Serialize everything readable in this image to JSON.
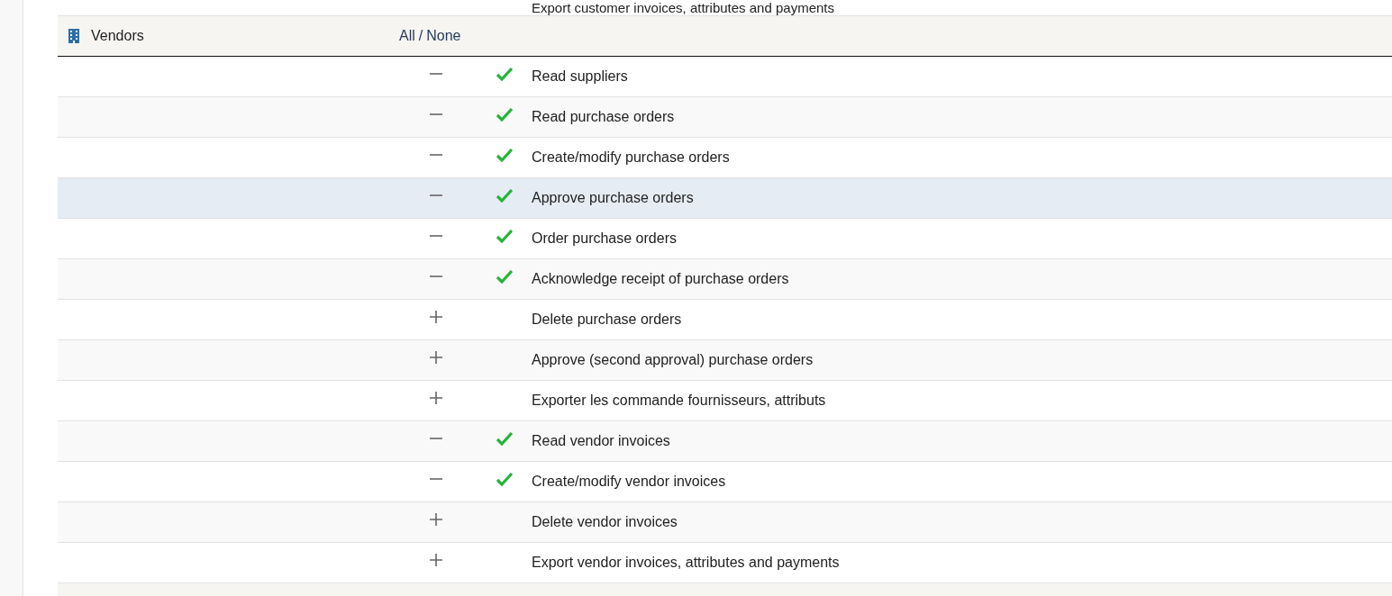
{
  "previous_row": {
    "label": "Export customer invoices, attributes and payments"
  },
  "section": {
    "title": "Vendors",
    "select_all": "All",
    "separator": "/",
    "select_none": "None"
  },
  "permissions": [
    {
      "label": "Read suppliers",
      "granted": true,
      "highlighted": false
    },
    {
      "label": "Read purchase orders",
      "granted": true,
      "highlighted": false
    },
    {
      "label": "Create/modify purchase orders",
      "granted": true,
      "highlighted": false
    },
    {
      "label": "Approve purchase orders",
      "granted": true,
      "highlighted": true
    },
    {
      "label": "Order purchase orders",
      "granted": true,
      "highlighted": false
    },
    {
      "label": "Acknowledge receipt of purchase orders",
      "granted": true,
      "highlighted": false
    },
    {
      "label": "Delete purchase orders",
      "granted": false,
      "highlighted": false
    },
    {
      "label": "Approve (second approval) purchase orders",
      "granted": false,
      "highlighted": false
    },
    {
      "label": "Exporter les commande fournisseurs, attributs",
      "granted": false,
      "highlighted": false
    },
    {
      "label": "Read vendor invoices",
      "granted": true,
      "highlighted": false
    },
    {
      "label": "Create/modify vendor invoices",
      "granted": true,
      "highlighted": false
    },
    {
      "label": "Delete vendor invoices",
      "granted": false,
      "highlighted": false
    },
    {
      "label": "Export vendor invoices, attributes and payments",
      "granted": false,
      "highlighted": false
    }
  ]
}
